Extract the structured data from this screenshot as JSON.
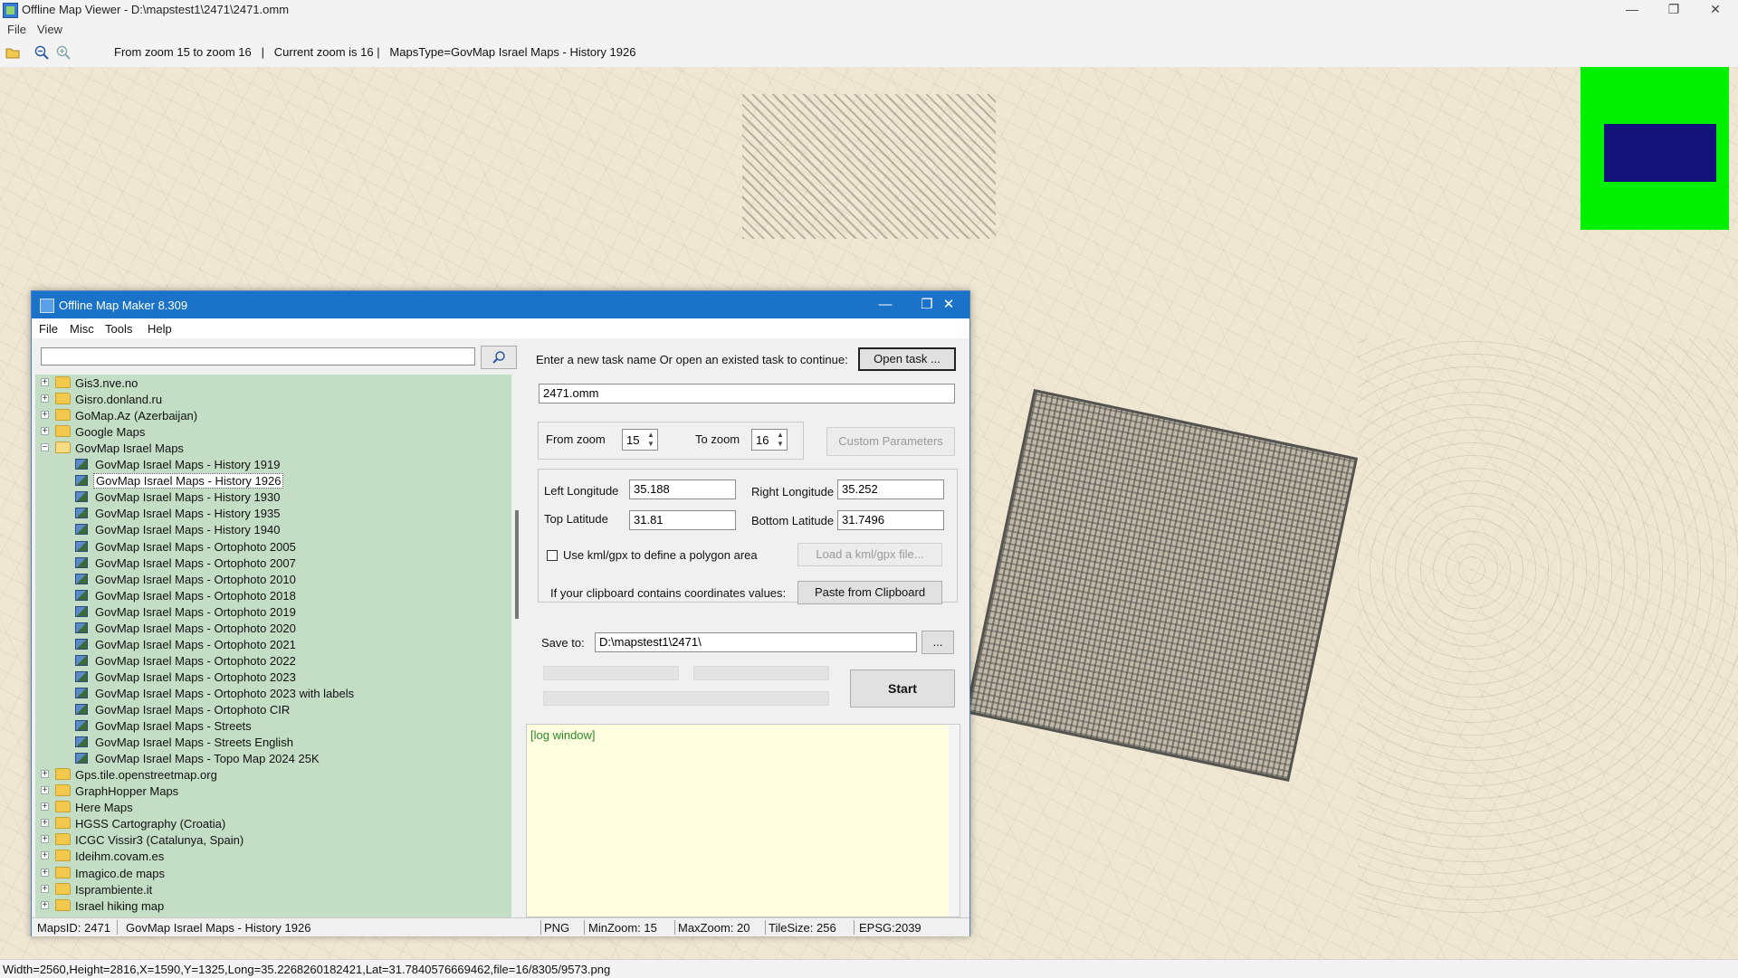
{
  "outer_window": {
    "title": "Offline Map Viewer - D:\\mapstest1\\2471\\2471.omm",
    "controls": [
      "—",
      "❐",
      "✕"
    ]
  },
  "outer_menu": [
    "File",
    "View"
  ],
  "toolbar": {
    "status": "From zoom 15 to zoom 16   |   Current zoom is 16 |   MapsType=GovMap Israel Maps - History 1926"
  },
  "bottom_status": "Width=2560,Height=2816,X=1590,Y=1325,Long=35.2268260182421,Lat=31.7840576669462,file=16/8305/9573.png",
  "dialog": {
    "title": "Offline Map Maker 8.309",
    "menu": [
      "File",
      "Misc",
      "Tools",
      "Help"
    ],
    "search": {
      "value": "",
      "placeholder": ""
    },
    "tree": [
      {
        "label": "Gis3.nve.no",
        "type": "folder",
        "expander": "+"
      },
      {
        "label": "Gisro.donland.ru",
        "type": "folder",
        "expander": "+"
      },
      {
        "label": "GoMap.Az (Azerbaijan)",
        "type": "folder",
        "expander": "+"
      },
      {
        "label": "Google Maps",
        "type": "folder",
        "expander": "+"
      },
      {
        "label": "GovMap Israel Maps",
        "type": "folder-open",
        "expander": "−"
      },
      {
        "label": "GovMap Israel Maps - History 1919",
        "type": "map"
      },
      {
        "label": "GovMap Israel Maps - History 1926",
        "type": "map",
        "selected": true
      },
      {
        "label": "GovMap Israel Maps - History 1930",
        "type": "map"
      },
      {
        "label": "GovMap Israel Maps - History 1935",
        "type": "map"
      },
      {
        "label": "GovMap Israel Maps - History 1940",
        "type": "map"
      },
      {
        "label": "GovMap Israel Maps - Ortophoto 2005",
        "type": "map"
      },
      {
        "label": "GovMap Israel Maps - Ortophoto 2007",
        "type": "map"
      },
      {
        "label": "GovMap Israel Maps - Ortophoto 2010",
        "type": "map"
      },
      {
        "label": "GovMap Israel Maps - Ortophoto 2018",
        "type": "map"
      },
      {
        "label": "GovMap Israel Maps - Ortophoto 2019",
        "type": "map"
      },
      {
        "label": "GovMap Israel Maps - Ortophoto 2020",
        "type": "map"
      },
      {
        "label": "GovMap Israel Maps - Ortophoto 2021",
        "type": "map"
      },
      {
        "label": "GovMap Israel Maps - Ortophoto 2022",
        "type": "map"
      },
      {
        "label": "GovMap Israel Maps - Ortophoto 2023",
        "type": "map"
      },
      {
        "label": "GovMap Israel Maps - Ortophoto 2023 with labels",
        "type": "map"
      },
      {
        "label": "GovMap Israel Maps - Ortophoto CIR",
        "type": "map"
      },
      {
        "label": "GovMap Israel Maps - Streets",
        "type": "map"
      },
      {
        "label": "GovMap Israel Maps - Streets English",
        "type": "map"
      },
      {
        "label": "GovMap Israel Maps - Topo Map 2024 25K",
        "type": "map"
      },
      {
        "label": "Gps.tile.openstreetmap.org",
        "type": "folder",
        "expander": "+"
      },
      {
        "label": "GraphHopper Maps",
        "type": "folder",
        "expander": "+"
      },
      {
        "label": "Here Maps",
        "type": "folder",
        "expander": "+"
      },
      {
        "label": "HGSS Cartography (Croatia)",
        "type": "folder",
        "expander": "+"
      },
      {
        "label": "ICGC Vissir3 (Catalunya, Spain)",
        "type": "folder",
        "expander": "+"
      },
      {
        "label": "Ideihm.covam.es",
        "type": "folder",
        "expander": "+"
      },
      {
        "label": "Imagico.de maps",
        "type": "folder",
        "expander": "+"
      },
      {
        "label": "Isprambiente.it",
        "type": "folder",
        "expander": "+"
      },
      {
        "label": "Israel hiking map",
        "type": "folder",
        "expander": "+"
      }
    ],
    "task": {
      "prompt": "Enter a new task name Or open an existed task to continue:",
      "open_button": "Open task ...",
      "name": "2471.omm"
    },
    "zoom": {
      "from_label": "From zoom",
      "from_value": "15",
      "to_label": "To zoom",
      "to_value": "16",
      "custom_button": "Custom Parameters"
    },
    "coords": {
      "left_lon_label": "Left Longitude",
      "left_lon": "35.188",
      "right_lon_label": "Right Longitude",
      "right_lon": "35.252",
      "top_lat_label": "Top Latitude",
      "top_lat": "31.81",
      "bottom_lat_label": "Bottom Latitude",
      "bottom_lat": "31.7496",
      "kml_label": "Use kml/gpx to define a polygon area",
      "kml_button": "Load a kml/gpx file...",
      "clipboard_label": "If your clipboard contains coordinates values:",
      "clipboard_button": "Paste from Clipboard"
    },
    "save": {
      "label": "Save to:",
      "path": "D:\\mapstest1\\2471\\",
      "browse": "..."
    },
    "start_button": "Start",
    "log_text": "[log window]",
    "status": {
      "maps_id": "MapsID: 2471",
      "map_name": "GovMap Israel Maps - History 1926",
      "format": "PNG",
      "min_zoom": "MinZoom: 15",
      "max_zoom": "MaxZoom: 20",
      "tile_size": "TileSize: 256",
      "epsg": "EPSG:2039"
    }
  },
  "colors": {
    "tree_bg": "#c3dec4",
    "dialog_title": "#1a73c9",
    "minimap_bg": "#00f000",
    "minimap_view": "#12127a",
    "log_bg": "#ffffe0"
  }
}
